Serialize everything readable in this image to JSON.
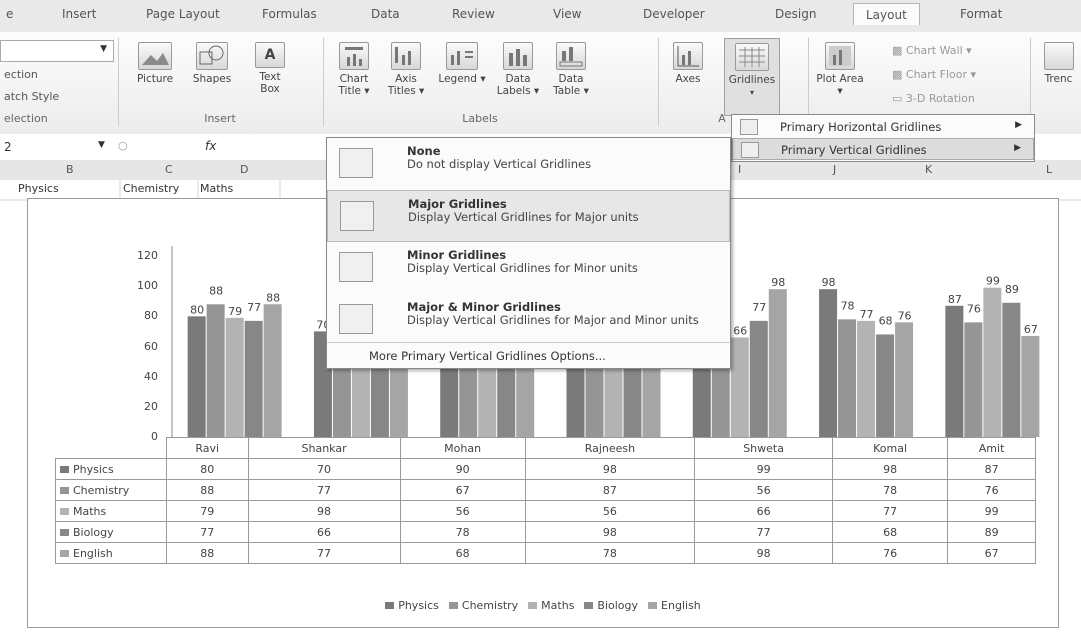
{
  "ribbon_tabs": [
    "e",
    "Insert",
    "Page Layout",
    "Formulas",
    "Data",
    "Review",
    "View",
    "Developer",
    "Design",
    "Layout",
    "Format"
  ],
  "active_tab": "Layout",
  "left_panel": {
    "lines": [
      "ection",
      "atch Style",
      "election"
    ]
  },
  "insert_group": {
    "label": "Insert",
    "buttons": [
      "Picture",
      "Shapes",
      "Text Box"
    ]
  },
  "labels_group": {
    "label": "Labels",
    "buttons": [
      "Chart Title ▾",
      "Axis Titles ▾",
      "Legend ▾",
      "Data Labels ▾",
      "Data Table ▾"
    ]
  },
  "axes_group": {
    "label": "A",
    "buttons": [
      "Axes",
      "Gridlines"
    ]
  },
  "background_group": {
    "buttons": [
      "Plot Area ▾"
    ],
    "options": [
      "Chart Wall ▾",
      "Chart Floor ▾",
      "3-D Rotation"
    ]
  },
  "trend_label": "Trenc",
  "name_box": "2",
  "fx": "fx",
  "column_headers": [
    "B",
    "C",
    "D",
    "I",
    "J",
    "K",
    "L"
  ],
  "sheet_cells": [
    "Physics",
    "Chemistry",
    "Maths"
  ],
  "submenu": {
    "items": [
      "Primary Horizontal Gridlines",
      "Primary Vertical Gridlines"
    ]
  },
  "menu": {
    "items": [
      {
        "title": "None",
        "desc": "Do not display Vertical Gridlines"
      },
      {
        "title": "Major Gridlines",
        "desc": "Display Vertical Gridlines for Major units"
      },
      {
        "title": "Minor Gridlines",
        "desc": "Display Vertical Gridlines for Minor units"
      },
      {
        "title": "Major & Minor Gridlines",
        "desc": "Display Vertical Gridlines for Major and Minor units"
      }
    ],
    "more": "More Primary Vertical Gridlines Options..."
  },
  "colors": {
    "Physics": "#7a7a7a",
    "Chemistry": "#959595",
    "Maths": "#b3b3b3",
    "Biology": "#878787",
    "English": "#a5a5a5"
  },
  "chart_data": {
    "type": "bar",
    "categories": [
      "Ravi",
      "Shankar",
      "Mohan",
      "Rajneesh",
      "Shweta",
      "Komal",
      "Amit"
    ],
    "series": [
      {
        "name": "Physics",
        "values": [
          80,
          70,
          90,
          98,
          99,
          98,
          87
        ]
      },
      {
        "name": "Chemistry",
        "values": [
          88,
          77,
          67,
          87,
          56,
          78,
          76
        ]
      },
      {
        "name": "Maths",
        "values": [
          79,
          98,
          56,
          56,
          66,
          77,
          99
        ]
      },
      {
        "name": "Biology",
        "values": [
          77,
          66,
          78,
          98,
          77,
          68,
          89
        ]
      },
      {
        "name": "English",
        "values": [
          88,
          77,
          68,
          78,
          98,
          76,
          67
        ]
      }
    ],
    "yticks": [
      0,
      20,
      40,
      60,
      80,
      100,
      120
    ],
    "ylim": [
      0,
      120
    ],
    "legend": "bottom",
    "data_table": true
  }
}
